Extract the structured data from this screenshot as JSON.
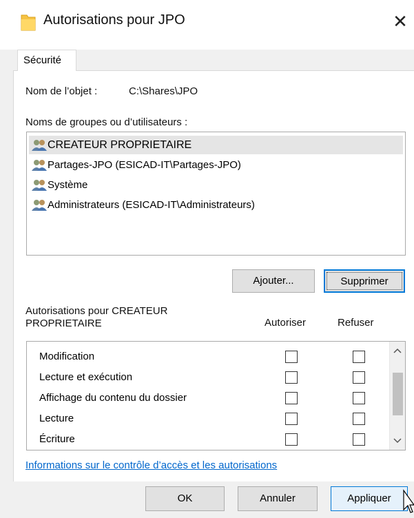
{
  "dialog": {
    "title": "Autorisations pour JPO",
    "close_glyph": "✕"
  },
  "tabs": [
    {
      "label": "Sécurité",
      "active": true
    }
  ],
  "object": {
    "label": "Nom de l’objet :",
    "value": "C:\\Shares\\JPO"
  },
  "groups": {
    "label": "Noms de groupes ou d’utilisateurs :",
    "items": [
      {
        "name": "CREATEUR PROPRIETAIRE",
        "icon": "users-icon",
        "selected": true
      },
      {
        "name": "Partages-JPO (ESICAD-IT\\Partages-JPO)",
        "icon": "users-icon",
        "selected": false
      },
      {
        "name": "Système",
        "icon": "users-icon",
        "selected": false
      },
      {
        "name": "Administrateurs (ESICAD-IT\\Administrateurs)",
        "icon": "users-icon",
        "selected": false
      }
    ]
  },
  "group_buttons": {
    "add": "Ajouter...",
    "remove": "Supprimer"
  },
  "permissions": {
    "header_line1": "Autorisations pour CREATEUR",
    "header_line2": "PROPRIETAIRE",
    "allow_label": "Autoriser",
    "deny_label": "Refuser",
    "rows": [
      {
        "name": "Modification",
        "allow": false,
        "deny": false
      },
      {
        "name": "Lecture et exécution",
        "allow": false,
        "deny": false
      },
      {
        "name": "Affichage du contenu du dossier",
        "allow": false,
        "deny": false
      },
      {
        "name": "Lecture",
        "allow": false,
        "deny": false
      },
      {
        "name": "Écriture",
        "allow": false,
        "deny": false
      }
    ]
  },
  "link_text": "Informations sur le contrôle d’accès et les autorisations",
  "footer_buttons": {
    "ok": "OK",
    "cancel": "Annuler",
    "apply": "Appliquer"
  },
  "colors": {
    "accent": "#0078d7",
    "link": "#0066cc",
    "folder": "#f6c343",
    "selection": "#e5e5e5"
  }
}
